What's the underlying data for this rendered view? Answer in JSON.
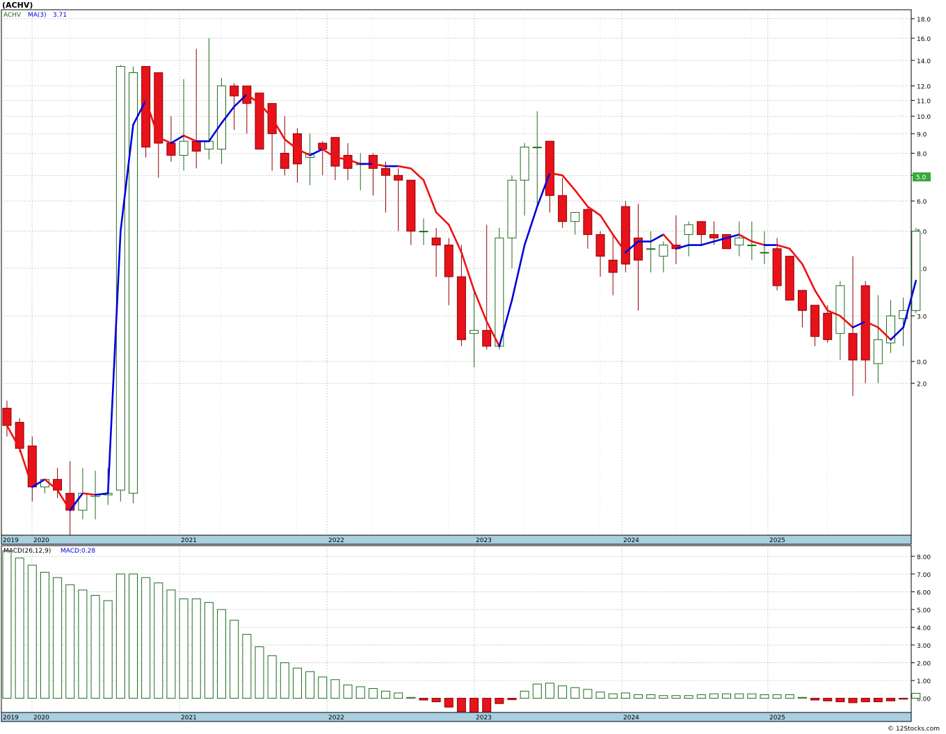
{
  "title": "(ACHV)",
  "copyright": "© 12Stocks.com",
  "colors": {
    "up_fill": "#ffffff",
    "up_stroke": "#1e6b1e",
    "down_fill": "#e8121b",
    "down_stroke": "#8b0000",
    "ma_up": "#0000dd",
    "ma_down": "#ee1111",
    "grid": "#b8b8b8",
    "axis_band": "#a9cfe0",
    "last_price_box": "#3aa83a"
  },
  "price_panel": {
    "legend": {
      "symbol": "ACHV",
      "ma_label": "MA(3)",
      "ma_value": "3.71"
    },
    "y_ticks": [
      "18.0",
      "16.0",
      "14.0",
      "12.0",
      "11.0",
      "10.0",
      "9.0",
      "8.0",
      "7.0",
      "6.0",
      "5.0",
      "4.0",
      "3.0",
      "2.0",
      "0.0"
    ],
    "last_price_label": "5.0"
  },
  "macd_panel": {
    "legend": {
      "label": "MACD(26,12,9)",
      "value_label": "MACD:0.28"
    },
    "y_ticks": [
      "8.00",
      "7.00",
      "6.00",
      "5.00",
      "4.00",
      "3.00",
      "2.00",
      "1.00",
      "0.00"
    ]
  },
  "x_axis_labels": [
    "2019",
    "2020",
    "2021",
    "2022",
    "2023",
    "2024",
    "2025"
  ],
  "chart_data": {
    "type": "candlestick",
    "interval": "monthly",
    "price_scale": "log",
    "price_ylim": [
      0.8,
      19
    ],
    "months": [
      "2019-12",
      "2020-01",
      "2020-02",
      "2020-03",
      "2020-04",
      "2020-05",
      "2020-06",
      "2020-07",
      "2020-08",
      "2020-09",
      "2020-10",
      "2020-11",
      "2020-12",
      "2021-01",
      "2021-02",
      "2021-03",
      "2021-04",
      "2021-05",
      "2021-06",
      "2021-07",
      "2021-08",
      "2021-09",
      "2021-10",
      "2021-11",
      "2021-12",
      "2022-01",
      "2022-02",
      "2022-03",
      "2022-04",
      "2022-05",
      "2022-06",
      "2022-07",
      "2022-08",
      "2022-09",
      "2022-10",
      "2022-11",
      "2022-12",
      "2023-01",
      "2023-02",
      "2023-03",
      "2023-04",
      "2023-05",
      "2023-06",
      "2023-07",
      "2023-08",
      "2023-09",
      "2023-10",
      "2023-11",
      "2023-12",
      "2024-01",
      "2024-02",
      "2024-03",
      "2024-04",
      "2024-05",
      "2024-06",
      "2024-07",
      "2024-08",
      "2024-09",
      "2024-10",
      "2024-11",
      "2024-12",
      "2025-01",
      "2025-02",
      "2025-03",
      "2025-04",
      "2025-05",
      "2025-06",
      "2025-07",
      "2025-08",
      "2025-09",
      "2025-10"
    ],
    "open": [
      1.72,
      1.58,
      1.37,
      1.07,
      1.12,
      1.03,
      0.93,
      1.01,
      1.02,
      1.05,
      1.03,
      13.5,
      13.0,
      8.5,
      7.9,
      8.6,
      8.2,
      8.2,
      12.0,
      12.0,
      11.5,
      10.8,
      8.0,
      9.0,
      7.8,
      8.5,
      8.8,
      7.9,
      7.5,
      7.9,
      7.3,
      7.0,
      6.8,
      5.0,
      4.8,
      4.6,
      3.8,
      2.7,
      2.75,
      2.5,
      4.8,
      6.8,
      8.3,
      8.6,
      6.2,
      5.3,
      5.7,
      4.9,
      4.2,
      5.8,
      4.8,
      4.5,
      4.3,
      4.6,
      4.9,
      5.3,
      4.9,
      4.9,
      4.6,
      4.6,
      4.4,
      4.5,
      4.3,
      3.5,
      3.2,
      3.05,
      2.7,
      2.7,
      3.6,
      2.25,
      2.55,
      2.95,
      3.1
    ],
    "close": [
      1.55,
      1.35,
      1.07,
      1.12,
      1.05,
      0.93,
      1.03,
      1.02,
      1.03,
      13.5,
      13.0,
      8.3,
      8.5,
      7.9,
      8.6,
      8.1,
      8.6,
      12.0,
      11.3,
      10.8,
      8.2,
      9.0,
      7.3,
      7.5,
      8.0,
      8.2,
      7.4,
      7.3,
      7.5,
      7.3,
      7.0,
      6.8,
      5.0,
      5.0,
      4.6,
      3.8,
      2.6,
      2.75,
      2.5,
      4.8,
      6.8,
      8.3,
      8.3,
      6.2,
      5.3,
      5.6,
      4.9,
      4.3,
      3.9,
      4.1,
      4.2,
      4.5,
      4.6,
      4.5,
      5.2,
      4.9,
      4.8,
      4.5,
      4.8,
      4.6,
      4.4,
      3.6,
      3.3,
      3.1,
      2.65,
      2.6,
      3.6,
      2.3,
      2.3,
      2.6,
      3.0,
      3.1,
      5.0
    ],
    "high": [
      1.8,
      1.62,
      1.45,
      1.12,
      1.2,
      1.25,
      1.2,
      1.18,
      1.2,
      13.6,
      13.5,
      9.8,
      10.2,
      10.0,
      12.5,
      15.0,
      16.0,
      12.6,
      12.2,
      11.8,
      11.0,
      10.0,
      10.0,
      9.3,
      9.0,
      8.6,
      8.8,
      8.5,
      8.0,
      8.0,
      7.6,
      7.3,
      6.8,
      5.4,
      5.1,
      4.8,
      4.6,
      3.5,
      5.2,
      5.1,
      7.0,
      8.5,
      10.3,
      8.6,
      6.9,
      5.6,
      5.8,
      5.0,
      4.9,
      6.0,
      5.9,
      5.0,
      4.7,
      5.5,
      5.3,
      5.2,
      5.3,
      4.9,
      5.3,
      5.3,
      5.0,
      4.8,
      3.8,
      3.3,
      3.2,
      3.2,
      3.7,
      4.3,
      3.7,
      3.4,
      3.3,
      3.35,
      5.1
    ],
    "low": [
      1.45,
      1.32,
      0.98,
      1.03,
      1.0,
      0.78,
      0.88,
      0.88,
      0.96,
      0.98,
      0.97,
      7.8,
      6.9,
      7.6,
      7.2,
      7.3,
      7.7,
      7.5,
      9.2,
      9.0,
      8.5,
      7.2,
      7.0,
      6.7,
      6.6,
      7.0,
      6.8,
      6.8,
      6.4,
      6.2,
      5.6,
      5.0,
      4.6,
      4.6,
      3.8,
      3.2,
      2.5,
      2.2,
      2.45,
      2.45,
      4.0,
      5.5,
      5.8,
      5.6,
      5.1,
      4.9,
      4.5,
      3.8,
      3.4,
      3.9,
      3.1,
      3.9,
      3.9,
      4.1,
      4.3,
      4.6,
      4.6,
      4.5,
      4.3,
      4.2,
      4.1,
      3.5,
      3.3,
      2.8,
      2.5,
      2.55,
      2.3,
      1.85,
      2.0,
      2.0,
      2.4,
      2.5,
      3.05
    ],
    "ma3": [
      1.55,
      1.35,
      1.07,
      1.12,
      1.05,
      0.93,
      1.03,
      1.02,
      1.03,
      5.0,
      9.5,
      11.0,
      8.8,
      8.5,
      8.9,
      8.6,
      8.6,
      9.6,
      10.6,
      11.4,
      10.8,
      9.9,
      8.7,
      8.2,
      7.9,
      8.2,
      7.8,
      7.7,
      7.5,
      7.5,
      7.4,
      7.4,
      7.3,
      6.8,
      5.6,
      5.2,
      4.4,
      3.5,
      2.9,
      2.5,
      3.3,
      4.6,
      5.8,
      7.1,
      7.0,
      6.4,
      5.8,
      5.5,
      4.9,
      4.4,
      4.7,
      4.7,
      4.9,
      4.5,
      4.6,
      4.6,
      4.7,
      4.8,
      4.9,
      4.7,
      4.6,
      4.6,
      4.5,
      4.1,
      3.5,
      3.1,
      3.0,
      2.8,
      2.9,
      2.8,
      2.6,
      2.8,
      3.71
    ],
    "macd": {
      "label": "MACD(26,12,9)",
      "ylim": [
        -0.8,
        8.6
      ],
      "values": [
        8.3,
        7.9,
        7.5,
        7.1,
        6.8,
        6.4,
        6.1,
        5.8,
        5.5,
        7.0,
        7.0,
        6.8,
        6.5,
        6.1,
        5.6,
        5.6,
        5.4,
        5.0,
        4.4,
        3.6,
        2.9,
        2.4,
        2.0,
        1.7,
        1.5,
        1.2,
        1.05,
        0.75,
        0.65,
        0.55,
        0.4,
        0.3,
        0.05,
        -0.1,
        -0.2,
        -0.5,
        -0.75,
        -0.8,
        -0.75,
        -0.3,
        -0.08,
        0.4,
        0.8,
        0.85,
        0.7,
        0.6,
        0.5,
        0.35,
        0.25,
        0.3,
        0.2,
        0.2,
        0.15,
        0.15,
        0.15,
        0.2,
        0.25,
        0.25,
        0.25,
        0.25,
        0.2,
        0.2,
        0.2,
        0.05,
        -0.1,
        -0.15,
        -0.2,
        -0.25,
        -0.2,
        -0.2,
        -0.15,
        -0.05,
        0.28
      ]
    }
  }
}
